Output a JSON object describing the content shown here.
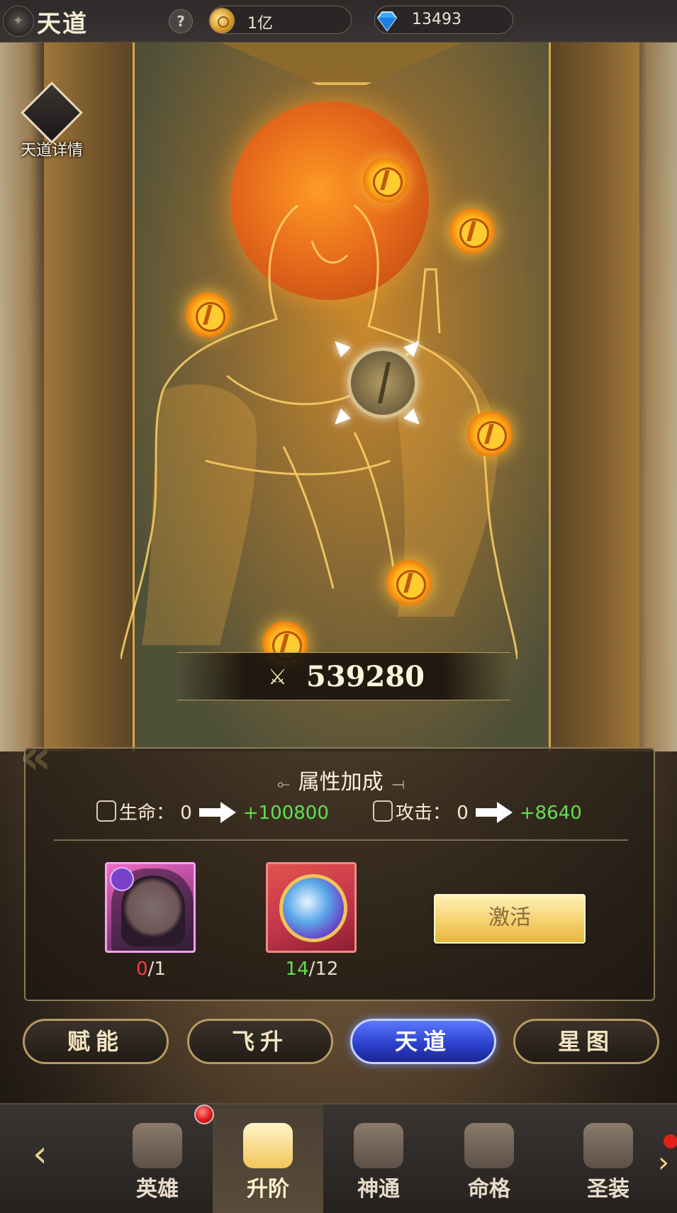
{
  "header": {
    "title": "天道",
    "help_label": "?",
    "gold_value": "1亿",
    "gem_value": "13493"
  },
  "detail": {
    "label": "天道详情"
  },
  "power": {
    "value": "539280"
  },
  "attributes": {
    "title": "属性加成",
    "hp": {
      "label": "生命：",
      "current": "0",
      "gain": "+100800"
    },
    "atk": {
      "label": "攻击：",
      "current": "0",
      "gain": "+8640"
    }
  },
  "items": [
    {
      "name": "hero",
      "have": "0",
      "need": "/1"
    },
    {
      "name": "orb",
      "have": "14",
      "need": "/12"
    }
  ],
  "activate_label": "激活",
  "subtabs": [
    "赋能",
    "飞升",
    "天道",
    "星图"
  ],
  "active_subtab": "天道",
  "nav": {
    "items": [
      "英雄",
      "升阶",
      "神通",
      "命格",
      "圣装"
    ],
    "active": "升阶"
  },
  "colors": {
    "gain_green": "#62e052",
    "shortage_red": "#ff3b3b",
    "active_tab_blue": "#2a3ec8",
    "accent_gold": "#f7d474"
  }
}
